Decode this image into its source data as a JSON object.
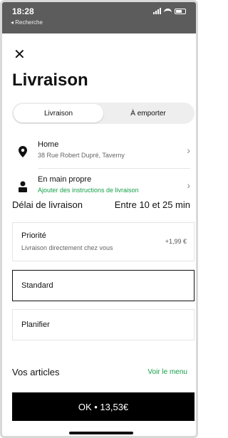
{
  "status_bar": {
    "time": "18:28",
    "back_label": "◂ Recherche"
  },
  "header": {
    "close_glyph": "✕",
    "title": "Livraison"
  },
  "mode_toggle": {
    "options": [
      "Livraison",
      "À emporter"
    ],
    "selected": "Livraison"
  },
  "address": {
    "label": "Home",
    "line": "38 Rue Robert Dupré, Taverny",
    "icon": "location-pin-icon"
  },
  "handoff": {
    "label": "En main propre",
    "instructions": "Ajouter des instructions de livraison",
    "icon": "person-icon",
    "instructions_color": "#15a04a"
  },
  "delivery_time": {
    "label": "Délai de livraison",
    "value": "Entre 10 et 25 min"
  },
  "options": [
    {
      "name": "Priorité",
      "desc": "Livraison directement chez vous",
      "price": "+1,99 €"
    },
    {
      "name": "Standard",
      "selected": true
    },
    {
      "name": "Planifier"
    }
  ],
  "articles": {
    "label": "Vos articles",
    "link": "Voir le menu"
  },
  "cta": {
    "label": "OK • 13,53€"
  }
}
